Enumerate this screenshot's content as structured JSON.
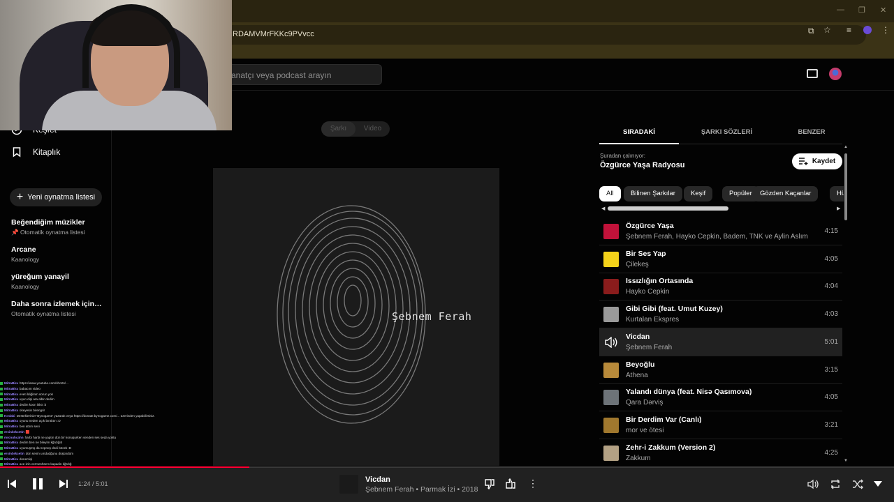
{
  "browser": {
    "url": "RDAMVMrFKKc9PVvcc"
  },
  "header": {
    "search_placeholder": "anatçı veya podcast arayın"
  },
  "sidebar": {
    "explore_label": "Keşfet",
    "library_label": "Kitaplık",
    "new_playlist_label": "Yeni oynatma listesi",
    "playlists": [
      {
        "title": "Beğendiğim müzikler",
        "subtitle": "📌 Otomatik oynatma listesi"
      },
      {
        "title": "Arcane",
        "subtitle": "Kaanology"
      },
      {
        "title": "yüreğum yanayil",
        "subtitle": "Kaanology"
      },
      {
        "title": "Daha sonra izlemek için kayd...",
        "subtitle": "Otomatik oynatma listesi"
      }
    ]
  },
  "toggle": {
    "song_label": "Şarkı",
    "video_label": "Video"
  },
  "album_art": {
    "artist_text": "Şebnem Ferah"
  },
  "panel": {
    "tabs": [
      "SIRADAKİ",
      "ŞARKI SÖZLERİ",
      "BENZER"
    ],
    "playing_from_label": "Şuradan çalınıyor:",
    "radio_name": "Özgürce Yaşa Radyosu",
    "save_label": "Kaydet",
    "chips": [
      "All",
      "Bilinen Şarkılar",
      "Keşif",
      "Popüler",
      "Gözden Kaçanlar",
      "Hüzün"
    ]
  },
  "queue": [
    {
      "title": "Özgürce Yaşa",
      "artist": "Şebnem Ferah, Hayko Cepkin, Badem, TNK ve Aylin Aslım",
      "duration": "4:15",
      "thumb_color": "#c1123a"
    },
    {
      "title": "Bir Ses Yap",
      "artist": "Çilekeş",
      "duration": "4:05",
      "thumb_color": "#f4d21a"
    },
    {
      "title": "Issızlığın Ortasında",
      "artist": "Hayko Cepkin",
      "duration": "4:04",
      "thumb_color": "#8a1c1c"
    },
    {
      "title": "Gibi Gibi (feat. Umut Kuzey)",
      "artist": "Kurtalan Ekspres",
      "duration": "4:03",
      "thumb_color": "#9a9a9a"
    },
    {
      "title": "Vicdan",
      "artist": "Şebnem Ferah",
      "duration": "5:01",
      "thumb_color": "#212121"
    },
    {
      "title": "Beyoğlu",
      "artist": "Athena",
      "duration": "3:15",
      "thumb_color": "#b88a3a"
    },
    {
      "title": "Yalandı dünya (feat. Nisə Qasımova)",
      "artist": "Qara Dərviş",
      "duration": "4:05",
      "thumb_color": "#6d7378"
    },
    {
      "title": "Bir Derdim Var (Canlı)",
      "artist": "mor ve ötesi",
      "duration": "3:21",
      "thumb_color": "#a0782e"
    },
    {
      "title": "Zehr-i Zakkum (Version 2)",
      "artist": "Zakkum",
      "duration": "4:25",
      "thumb_color": "#b3a184"
    }
  ],
  "player": {
    "time_text": "1:24 / 5:01",
    "progress_fraction": 0.279,
    "now_playing_title": "Vicdan",
    "now_playing_sub": "Şebnem Ferah • Parmak İzi • 2018"
  },
  "chat": [
    {
      "user": "MitraBira",
      "text": "https://www.youtube.com/shorts/..."
    },
    {
      "user": "MitraBira",
      "text": "babacım video"
    },
    {
      "user": "MitraBira",
      "text": "evet ildiğimm sorun yok"
    },
    {
      "user": "MitraBira",
      "text": "uşun dişi ara albir dedim"
    },
    {
      "user": "MitraBira",
      "text": "dedim koon ikkö :b"
    },
    {
      "user": "MitraBira",
      "text": "okeyesin birengrir"
    },
    {
      "user": "Kırdaki",
      "text": "Destekleriniz! 'Bynogame' yazarak veya https://donate.bynogame.com/... üzerinden yapabilirsiniz."
    },
    {
      "user": "MitraBira",
      "text": "oyunu neden açık bıraktın :D"
    },
    {
      "user": "MitraBira",
      "text": "ben attım seni"
    },
    {
      "user": "ersinbrkcetin",
      "text": "🟥"
    },
    {
      "user": "mrcnuhcahn",
      "text": "harbi harbi ne yaptın dün bir konuşurken senden ses seda yoktu"
    },
    {
      "user": "MitraBira",
      "text": "dedim ben ne bileyim kğrdığıb"
    },
    {
      "user": "MitraBira",
      "text": "uyumuşmş da nepnoş dedi böcek :D"
    },
    {
      "user": "ersinbrkcetin",
      "text": "dün senin uındudğunu düşündüm"
    },
    {
      "user": "MitraBira",
      "text": "denemişi"
    },
    {
      "user": "MitraBira",
      "text": "ace izin vermeshsem kapadin kğrdığ"
    },
    {
      "user": "MitraBira",
      "text": "yok"
    },
    {
      "user": "MitraBira",
      "text": "ekranı paylaşma"
    },
    {
      "user": "MitraBira",
      "text": "tmi selam"
    },
    {
      "user": "MitraBira",
      "text": "video önerisi isiter misin"
    },
    {
      "user": "mrcnuhcahn",
      "text": "koyabilir ak :)"
    }
  ],
  "colors": {
    "accent": "#ff0033",
    "background": "#030303"
  }
}
